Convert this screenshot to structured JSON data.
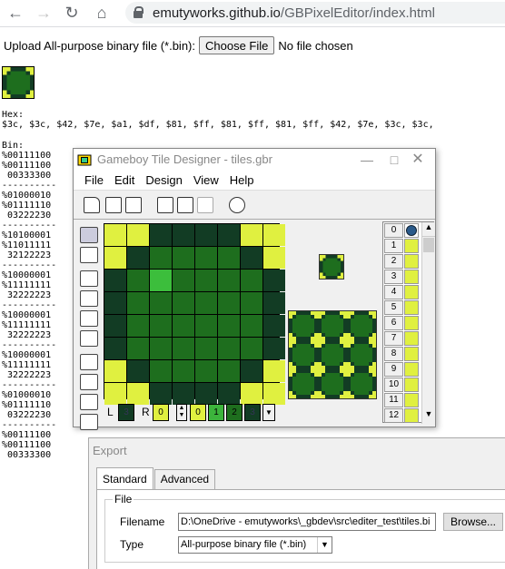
{
  "browser": {
    "url_host": "emutyworks.github.io",
    "url_path": "/GBPixelEditor/index.html"
  },
  "page": {
    "upload_label": "Upload All-purpose binary file (*.bin):",
    "choose_label": "Choose File",
    "no_file": "No file chosen",
    "hex_label": "Hex:",
    "hex_values": "$3c, $3c, $42, $7e, $a1, $df, $81, $ff, $81, $ff, $81, $ff, $42, $7e, $3c, $3c,",
    "bin_label": "Bin:",
    "bin_lines": [
      "%00111100",
      "%00111100",
      " 00333300",
      "----------",
      "%01000010",
      "%01111110",
      " 03222230",
      "----------",
      "%10100001",
      "%11011111",
      " 32122223",
      "----------",
      "%10000001",
      "%11111111",
      " 32222223",
      "----------",
      "%10000001",
      "%11111111",
      " 32222223",
      "----------",
      "%10000001",
      "%11111111",
      " 32222223",
      "----------",
      "%01000010",
      "%01111110",
      " 03222230",
      "----------",
      "%00111100",
      "%00111100",
      " 00333300"
    ]
  },
  "gtd": {
    "title": "Gameboy Tile Designer - tiles.gbr",
    "menu": [
      "File",
      "Edit",
      "Design",
      "View",
      "Help"
    ],
    "pixels": [
      [
        0,
        0,
        3,
        3,
        3,
        3,
        0,
        0
      ],
      [
        0,
        3,
        2,
        2,
        2,
        2,
        3,
        0
      ],
      [
        3,
        2,
        "h",
        2,
        2,
        2,
        2,
        3
      ],
      [
        3,
        2,
        2,
        2,
        2,
        2,
        2,
        3
      ],
      [
        3,
        2,
        2,
        2,
        2,
        2,
        2,
        3
      ],
      [
        3,
        2,
        2,
        2,
        2,
        2,
        2,
        3
      ],
      [
        0,
        3,
        2,
        2,
        2,
        2,
        3,
        0
      ],
      [
        0,
        0,
        3,
        3,
        3,
        3,
        0,
        0
      ]
    ],
    "left_label": "L",
    "left_value": "3",
    "right_label": "R",
    "right_value": "0",
    "palette": [
      "0",
      "1",
      "2",
      "3"
    ],
    "tile_numbers": [
      "0",
      "1",
      "2",
      "3",
      "4",
      "5",
      "6",
      "7",
      "8",
      "9",
      "10",
      "11",
      "12"
    ],
    "colors": {
      "c0": "#e0f040",
      "c1": "#2a8a2a",
      "c2": "#1e6e1e",
      "c3": "#123c24"
    }
  },
  "export": {
    "title": "Export",
    "tabs": [
      "Standard",
      "Advanced"
    ],
    "group_label": "File",
    "filename_label": "Filename",
    "filename_value": "D:\\OneDrive - emutyworks\\_gbdev\\src\\editer_test\\tiles.bi",
    "browse_label": "Browse...",
    "type_label": "Type",
    "type_value": "All-purpose binary file (*.bin)"
  }
}
